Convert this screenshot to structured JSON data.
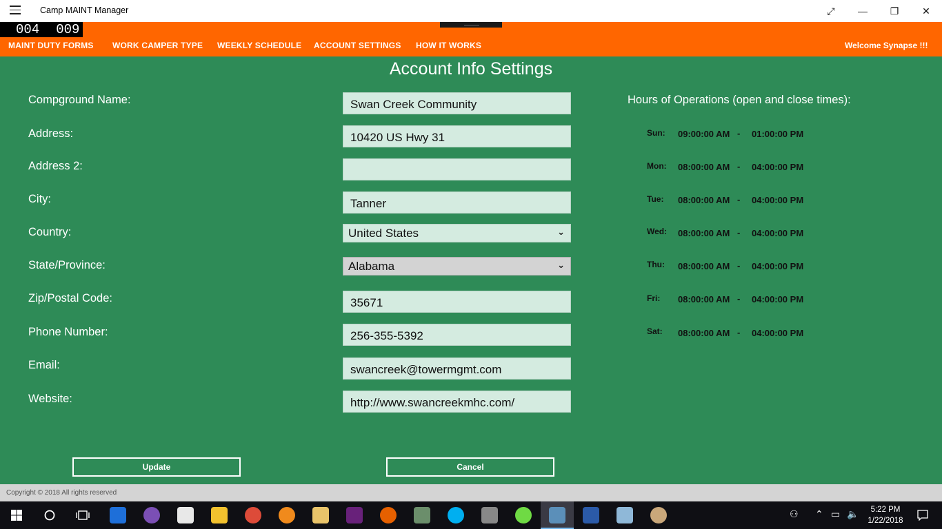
{
  "window": {
    "title": "Camp MAINT Manager"
  },
  "counter": {
    "left": "004",
    "right": "009"
  },
  "nav": {
    "items": [
      "MAINT DUTY FORMS",
      "WORK CAMPER TYPE",
      "WEEKLY SCHEDULE",
      "ACCOUNT SETTINGS",
      "HOW IT WORKS"
    ],
    "welcome": "Welcome  Synapse  !!!"
  },
  "page": {
    "title": "Account Info Settings"
  },
  "form": {
    "campground_label": "Compground Name:",
    "campground_value": "Swan Creek Community",
    "address_label": "Address:",
    "address_value": "10420 US Hwy 31",
    "address2_label": "Address 2:",
    "address2_value": "",
    "city_label": "City:",
    "city_value": "Tanner",
    "country_label": "Country:",
    "country_value": "United States",
    "state_label": "State/Province:",
    "state_value": "Alabama",
    "zip_label": "Zip/Postal Code:",
    "zip_value": "35671",
    "phone_label": "Phone Number:",
    "phone_value": "256-355-5392",
    "email_label": "Email:",
    "email_value": "swancreek@towermgmt.com",
    "website_label": "Website:",
    "website_value": "http://www.swancreekmhc.com/"
  },
  "hours": {
    "title": "Hours of Operations (open and close times):",
    "days": [
      {
        "day": "Sun:",
        "open": "09:00:00 AM",
        "close": "01:00:00 PM"
      },
      {
        "day": "Mon:",
        "open": "08:00:00 AM",
        "close": "04:00:00 PM"
      },
      {
        "day": "Tue:",
        "open": "08:00:00 AM",
        "close": "04:00:00 PM"
      },
      {
        "day": "Wed:",
        "open": "08:00:00 AM",
        "close": "04:00:00 PM"
      },
      {
        "day": "Thu:",
        "open": "08:00:00 AM",
        "close": "04:00:00 PM"
      },
      {
        "day": "Fri:",
        "open": "08:00:00 AM",
        "close": "04:00:00 PM"
      },
      {
        "day": "Sat:",
        "open": "08:00:00 AM",
        "close": "04:00:00 PM"
      }
    ],
    "separator": "-"
  },
  "buttons": {
    "update": "Update",
    "cancel": "Cancel"
  },
  "footer": {
    "copyright": "Copyright © 2018 All rights reserved"
  },
  "taskbar": {
    "time": "5:22 PM",
    "date": "1/22/2018",
    "apps": [
      "edge-icon",
      "cat-app-icon",
      "vs-code-icon",
      "file-explorer-icon",
      "chrome-icon",
      "fire-app-icon",
      "mail-icon",
      "visual-studio-icon",
      "firefox-icon",
      "photos-icon",
      "skype-icon",
      "tools-icon",
      "upwork-icon",
      "camp-app-icon",
      "remote-desktop-icon",
      "notes-icon",
      "paint-icon"
    ]
  },
  "colors": {
    "background": "#2e8b57",
    "navbar": "#ff6600",
    "field": "#d4ebe0"
  }
}
